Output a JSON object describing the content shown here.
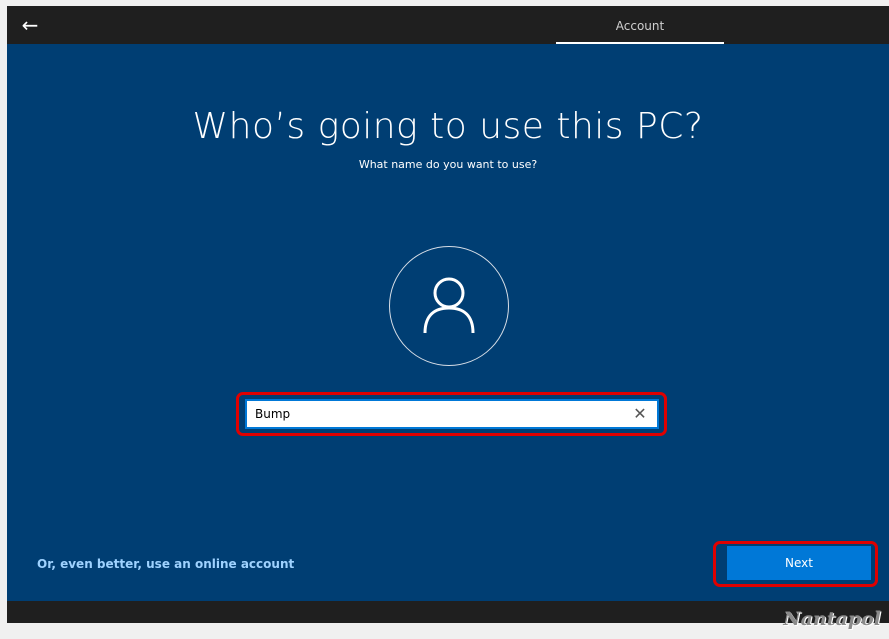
{
  "header": {
    "back_icon": "arrow-left-icon",
    "tab_label": "Account"
  },
  "main": {
    "title": "Who’s going to use this PC?",
    "subtitle": "What name do you want to use?",
    "avatar_icon": "user-icon",
    "name_value": "Bump",
    "clear_icon": "close-icon"
  },
  "footer": {
    "online_account_link": "Or, even better, use an online account",
    "next_label": "Next"
  },
  "watermark": "Nantapol",
  "colors": {
    "panel": "#003e73",
    "topbar": "#1f1f1f",
    "accent": "#0078d7",
    "link": "#9ed2ff",
    "highlight": "#e00000"
  }
}
